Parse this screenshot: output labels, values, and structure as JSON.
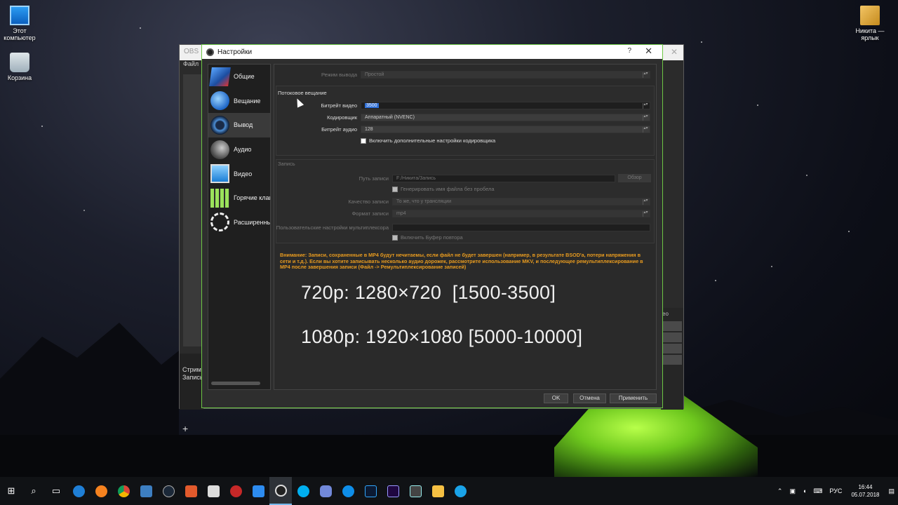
{
  "desktop": {
    "icons": [
      {
        "label": "Этот компьютер",
        "icon": "computer-icon"
      },
      {
        "label": "Корзина",
        "icon": "recycle-bin-icon"
      },
      {
        "label": "Никита — ярлык",
        "icon": "shortcut-icon"
      }
    ]
  },
  "obs_main": {
    "title": "OBS",
    "menu_file": "Файл",
    "panel_stream": "Стрим",
    "panel_record": "Запись",
    "add_label": "+",
    "right_label": "ео"
  },
  "settings": {
    "title": "Настройки",
    "help": "?",
    "close": "✕",
    "sidebar": [
      {
        "label": "Общие",
        "icon": "general-icon"
      },
      {
        "label": "Вещание",
        "icon": "stream-icon"
      },
      {
        "label": "Вывод",
        "icon": "output-icon"
      },
      {
        "label": "Аудио",
        "icon": "audio-icon"
      },
      {
        "label": "Видео",
        "icon": "video-icon"
      },
      {
        "label": "Горячие клави",
        "icon": "hotkeys-icon"
      },
      {
        "label": "Расширенные",
        "icon": "advanced-icon"
      }
    ],
    "output_mode_label": "Режим вывода",
    "output_mode_value": "Простой",
    "streaming": {
      "title": "Потоковое вещание",
      "video_bitrate_label": "Битрейт видео",
      "video_bitrate_value": "3500",
      "encoder_label": "Кодировщик",
      "encoder_value": "Аппаратный (NVENC)",
      "audio_bitrate_label": "Битрейт аудио",
      "audio_bitrate_value": "128",
      "advanced_encoder_checkbox": "Включить дополнительные настройки кодировщика"
    },
    "recording": {
      "title": "Запись",
      "path_label": "Путь записи",
      "path_value": "F:/Никита/Запись",
      "browse_button": "Обзор",
      "no_space_checkbox": "Генерировать имя файла без пробела",
      "quality_label": "Качество записи",
      "quality_value": "То же, что у трансляции",
      "format_label": "Формат записи",
      "format_value": "mp4",
      "muxer_label": "Пользовательские настройки мультиплексора",
      "muxer_value": "",
      "replay_buffer_checkbox": "Включить Буфер повтора"
    },
    "warning": "Внимание: Записи, сохраненные в MP4 будут нечитаемы, если файл не будет завершен (например, в результате BSOD'а, потери напряжения в сети и т.д.). Если вы хотите записывать несколько аудио дорожек, рассмотрите использование MKV, и последующее ремультиплексирование в MP4 после завершения записи (Файл -> Ремультиплексирование записей)",
    "overlay_line1": "720p: 1280×720  [1500-3500]",
    "overlay_line2": "1080p: 1920×1080 [5000-10000]",
    "ok_button": "OK",
    "cancel_button": "Отмена",
    "apply_button": "Применить"
  },
  "taskbar": {
    "apps": [
      "start-icon",
      "search-icon",
      "task-view-icon",
      "edge-icon",
      "firefox-icon",
      "chrome-icon",
      "app-icon",
      "steam-icon",
      "app-icon",
      "folder-icon",
      "game-icon",
      "chat-icon",
      "obs-icon",
      "skype-icon",
      "discord-icon",
      "teamviewer-icon",
      "photoshop-icon",
      "after-effects-icon",
      "video-editor-icon",
      "explorer-icon",
      "app-icon"
    ],
    "lang": "РУС",
    "time": "16:44",
    "date": "05.07.2018"
  }
}
